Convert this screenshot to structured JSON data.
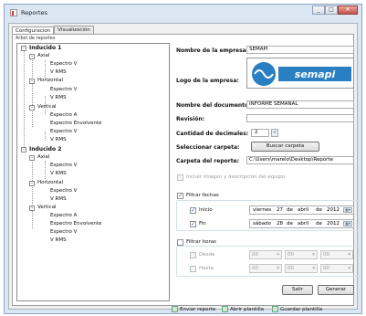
{
  "window": {
    "title": "Reportes",
    "btn_min": "_",
    "btn_max": "□",
    "btn_close": "✕"
  },
  "tabs": [
    {
      "label": "Configuracion"
    },
    {
      "label": "Visualización"
    }
  ],
  "tree": {
    "label": "Arbol de reportes",
    "nodes": [
      {
        "text": "Inducido 1",
        "expander": "–"
      },
      {
        "text": "Axial",
        "expander": "–"
      },
      {
        "text": "Espectro V"
      },
      {
        "text": "V RMS"
      },
      {
        "text": "Horizontal",
        "expander": "–"
      },
      {
        "text": "Espectro V"
      },
      {
        "text": "V RMS"
      },
      {
        "text": "Vertical",
        "expander": "–"
      },
      {
        "text": "Espectro A"
      },
      {
        "text": "Espectro Envolvente"
      },
      {
        "text": "Espectro V"
      },
      {
        "text": "V RMS"
      },
      {
        "text": "Inducido 2",
        "expander": "–"
      },
      {
        "text": "Axial",
        "expander": "–"
      },
      {
        "text": "Espectro V"
      },
      {
        "text": "V RMS"
      },
      {
        "text": "Horizontal",
        "expander": "–"
      },
      {
        "text": "Espectro V"
      },
      {
        "text": "V RMS"
      },
      {
        "text": "Vertical",
        "expander": "–"
      },
      {
        "text": "Espectro A"
      },
      {
        "text": "Espectro Envolvente"
      },
      {
        "text": "Espectro V"
      },
      {
        "text": "V RMS"
      }
    ]
  },
  "form": {
    "empresa_label": "Nombre de la empresa:",
    "empresa_value": "SEMAPI",
    "logo_label": "Logo de la empresa:",
    "logo_text": "semapi",
    "documento_label": "Nombre del documento:",
    "documento_value": "INFORME SEMANAL",
    "revision_label": "Revisión:",
    "revision_value": "",
    "decimales_label": "Cantidad de decimales:",
    "decimales_value": "2",
    "spin_icon": "÷",
    "seleccionar_label": "Seleccionar carpeta:",
    "buscar_button": "Buscar carpeta",
    "carpeta_label": "Carpeta del reporte:",
    "carpeta_value": "C:\\Users\\marelo\\Desktop\\Reporte",
    "incluir_label": "Incluir imagen y descripción del equipo",
    "filtrar_fechas_label": "Filtrar fechas",
    "check": "✓",
    "inicio_label": "Inicio",
    "inicio_date": {
      "wd": "viernes",
      "d": "27",
      "de": "de",
      "m": "abril",
      "y": "2012"
    },
    "fin_label": "Fin",
    "fin_date": {
      "wd": "sábado",
      "d": "28",
      "de": "de",
      "m": "abril",
      "y": "2012"
    },
    "cal_icon": "▦▾",
    "filtrar_horas_label": "Filtrar horas",
    "desde_label": "Desde",
    "hasta_label": "Hasta",
    "time_value": "00",
    "salir_button": "Salir",
    "generar_button": "Generar"
  },
  "footer": {
    "enviar": "Enviar reporte",
    "abrir": "Abrir plantilla",
    "guardar": "Guardar plantilla"
  }
}
